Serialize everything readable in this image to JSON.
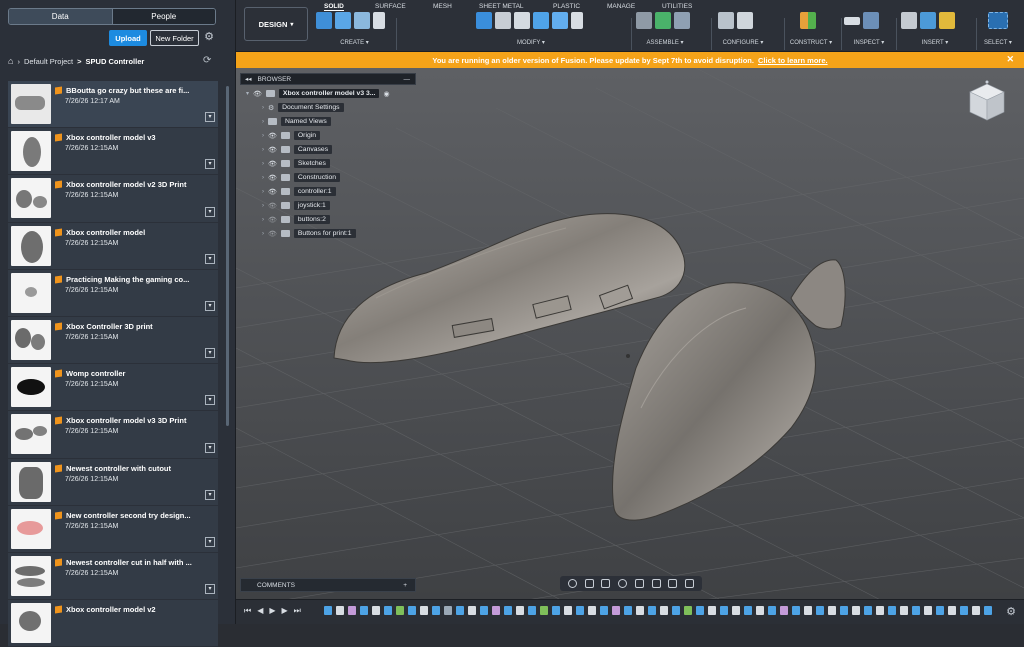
{
  "left_panel": {
    "tabs": [
      "Data",
      "People"
    ],
    "upload_label": "Upload",
    "new_folder_label": "New Folder",
    "breadcrumb": {
      "project": "Default Project",
      "separator": ">",
      "folder": "SPUD Controller"
    },
    "files": [
      {
        "name": "BBoutta go crazy but these are fi...",
        "date": "7/26/26 12:17 AM"
      },
      {
        "name": "Xbox controller model v3",
        "date": "7/26/26 12:15AM"
      },
      {
        "name": "Xbox controller model v2 3D Print",
        "date": "7/26/26 12:15AM"
      },
      {
        "name": "Xbox controller model",
        "date": "7/26/26 12:15AM"
      },
      {
        "name": "Practicing Making the gaming co...",
        "date": "7/26/26 12:15AM"
      },
      {
        "name": "Xbox Controller 3D print",
        "date": "7/26/26 12:15AM"
      },
      {
        "name": "Womp controller",
        "date": "7/26/26 12:15AM"
      },
      {
        "name": "Xbox controller model v3 3D Print",
        "date": "7/26/26 12:15AM"
      },
      {
        "name": "Newest controller with cutout",
        "date": "7/26/26 12:15AM"
      },
      {
        "name": "New controller second try design...",
        "date": "7/26/26 12:15AM"
      },
      {
        "name": "Newest controller cut in half with ...",
        "date": "7/26/26 12:15AM"
      },
      {
        "name": "Xbox controller model v2",
        "date": ""
      }
    ]
  },
  "toolbar": {
    "workspace": "DESIGN",
    "tabs": [
      "SOLID",
      "SURFACE",
      "MESH",
      "SHEET METAL",
      "PLASTIC",
      "MANAGE",
      "UTILITIES"
    ],
    "active_tab": "SOLID",
    "groups": [
      "CREATE",
      "MODIFY",
      "ASSEMBLE",
      "CONFIGURE",
      "CONSTRUCT",
      "INSPECT",
      "INSERT",
      "SELECT"
    ]
  },
  "notice": {
    "text": "You are running an older version of Fusion. Please update by Sept 7th to avoid disruption.",
    "link": "Click to learn more."
  },
  "browser": {
    "title": "BROWSER",
    "root": "Xbox controller model v3 3...",
    "items": [
      "Document Settings",
      "Named Views",
      "Origin",
      "Canvases",
      "Sketches",
      "Construction",
      "controller:1",
      "joystick:1",
      "buttons:2",
      "Buttons for print:1"
    ]
  },
  "comments": {
    "title": "COMMENTS"
  },
  "colors": {
    "accent": "#1d8be0",
    "notice": "#f5a319",
    "file_icon": "#f0941c"
  }
}
